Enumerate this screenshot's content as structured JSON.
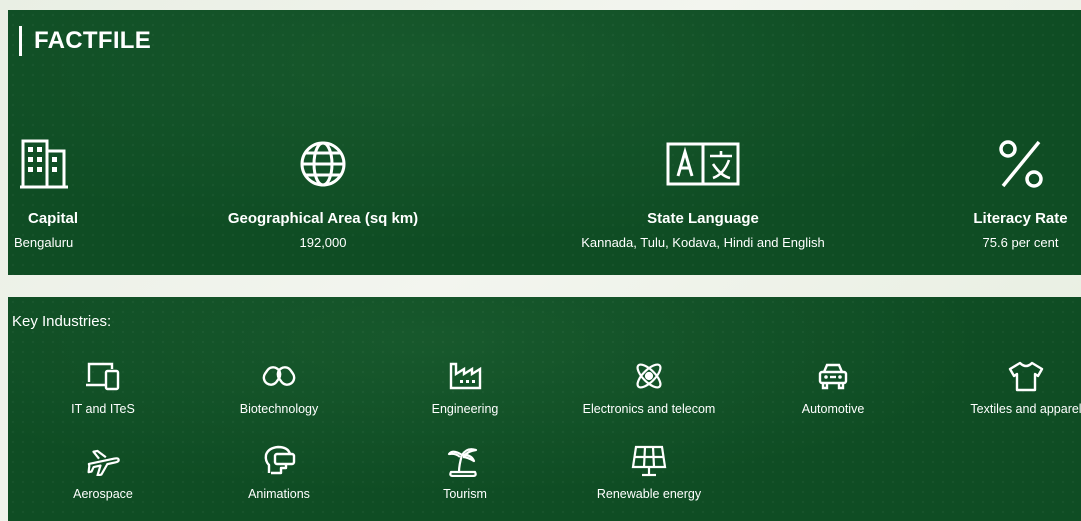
{
  "factfile": {
    "title": "FACTFILE",
    "facts": [
      {
        "label": "Capital",
        "value": "Bengaluru",
        "icon": "building-icon"
      },
      {
        "label": "Geographical Area (sq km)",
        "value": "192,000",
        "icon": "globe-icon"
      },
      {
        "label": "State Language",
        "value": "Kannada, Tulu, Kodava, Hindi and English",
        "icon": "translate-icon"
      },
      {
        "label": "Literacy Rate",
        "value": "75.6 per cent",
        "icon": "percent-icon"
      }
    ]
  },
  "industries": {
    "title": "Key Industries:",
    "items": [
      {
        "label": "IT and ITeS",
        "icon": "devices-icon"
      },
      {
        "label": "Biotechnology",
        "icon": "capsule-icon"
      },
      {
        "label": "Engineering",
        "icon": "factory-icon"
      },
      {
        "label": "Electronics and telecom",
        "icon": "atom-icon"
      },
      {
        "label": "Automotive",
        "icon": "car-icon"
      },
      {
        "label": "Textiles and apparel",
        "icon": "tshirt-icon"
      },
      {
        "label": "Aerospace",
        "icon": "airplane-icon"
      },
      {
        "label": "Animations",
        "icon": "vr-headset-icon"
      },
      {
        "label": "Tourism",
        "icon": "palm-island-icon"
      },
      {
        "label": "Renewable energy",
        "icon": "solar-panel-icon"
      }
    ]
  },
  "colors": {
    "panel_bg": "#0f4d24",
    "text": "#ffffff",
    "page_bg": "#eef2ea"
  }
}
